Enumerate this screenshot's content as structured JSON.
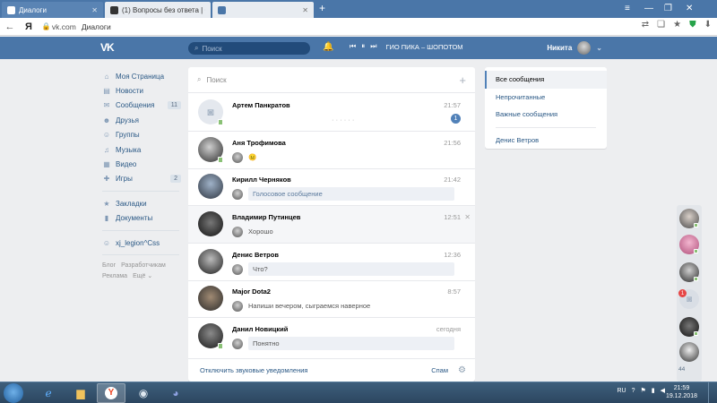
{
  "browser": {
    "tabs": [
      {
        "title": "Диалоги",
        "active": true
      },
      {
        "title": "(1) Вопросы без ответа | Ст",
        "active": false
      },
      {
        "title": "",
        "active": false
      }
    ],
    "new_tab": "+",
    "back": "←",
    "yandex_logo": "Я",
    "url_domain": "vk.com",
    "url_title": "Диалоги"
  },
  "vk": {
    "logo": "VK",
    "search_placeholder": "Поиск",
    "player_track": "ГИО ПИКА – ШОПОТОМ",
    "user_name": "Никита",
    "user_chevron": "⌄"
  },
  "left_menu": {
    "items": [
      {
        "icon": "home-icon",
        "label": "Моя Страница",
        "count": ""
      },
      {
        "icon": "news-icon",
        "label": "Новости",
        "count": ""
      },
      {
        "icon": "messages-icon",
        "label": "Сообщения",
        "count": "11"
      },
      {
        "icon": "friends-icon",
        "label": "Друзья",
        "count": ""
      },
      {
        "icon": "groups-icon",
        "label": "Группы",
        "count": ""
      },
      {
        "icon": "music-icon",
        "label": "Музыка",
        "count": ""
      },
      {
        "icon": "video-icon",
        "label": "Видео",
        "count": ""
      },
      {
        "icon": "games-icon",
        "label": "Игры",
        "count": "2"
      }
    ],
    "items2": [
      {
        "icon": "bookmarks-icon",
        "label": "Закладки"
      },
      {
        "icon": "documents-icon",
        "label": "Документы"
      }
    ],
    "group": {
      "label": "xj_legion^Css"
    },
    "footer": [
      "Блог",
      "Разработчикам",
      "Реклама",
      "Ещё ⌄"
    ]
  },
  "dialogs": {
    "search_placeholder": "Поиск",
    "rows": [
      {
        "name": "Артем Панкратов",
        "time": "21:57",
        "message": "· · · · · ·",
        "bubble": false,
        "unread": "1",
        "online": true
      },
      {
        "name": "Аня Трофимова",
        "time": "21:56",
        "message": "😐",
        "bubble": false,
        "unread": "",
        "online": true
      },
      {
        "name": "Кирилл Черняков",
        "time": "21:42",
        "message": "Голосовое сообщение",
        "bubble": true,
        "unread": "",
        "online": false
      },
      {
        "name": "Владимир Путинцев",
        "time": "12:51",
        "message": "Хорошо",
        "bubble": false,
        "unread": "",
        "online": false
      },
      {
        "name": "Денис Ветров",
        "time": "12:36",
        "message": "Что?",
        "bubble": true,
        "unread": "",
        "online": false
      },
      {
        "name": "Major Dota2",
        "time": "8:57",
        "message": "Напиши вечером, сыграемся наверное",
        "bubble": false,
        "unread": "",
        "online": false
      },
      {
        "name": "Данил Новицкий",
        "time": "сегодня",
        "message": "Понятно",
        "bubble": true,
        "unread": "",
        "online": true
      }
    ],
    "footer_mute": "Отключить звуковые уведомления",
    "footer_spam": "Спам"
  },
  "filters": {
    "items": [
      "Все сообщения",
      "Непрочитанные",
      "Важные сообщения"
    ],
    "contact": "Денис Ветров"
  },
  "chat_column": {
    "badge": "1",
    "more_count": "44"
  },
  "taskbar": {
    "lang": "RU",
    "time": "21:59",
    "date": "19.12.2018"
  }
}
